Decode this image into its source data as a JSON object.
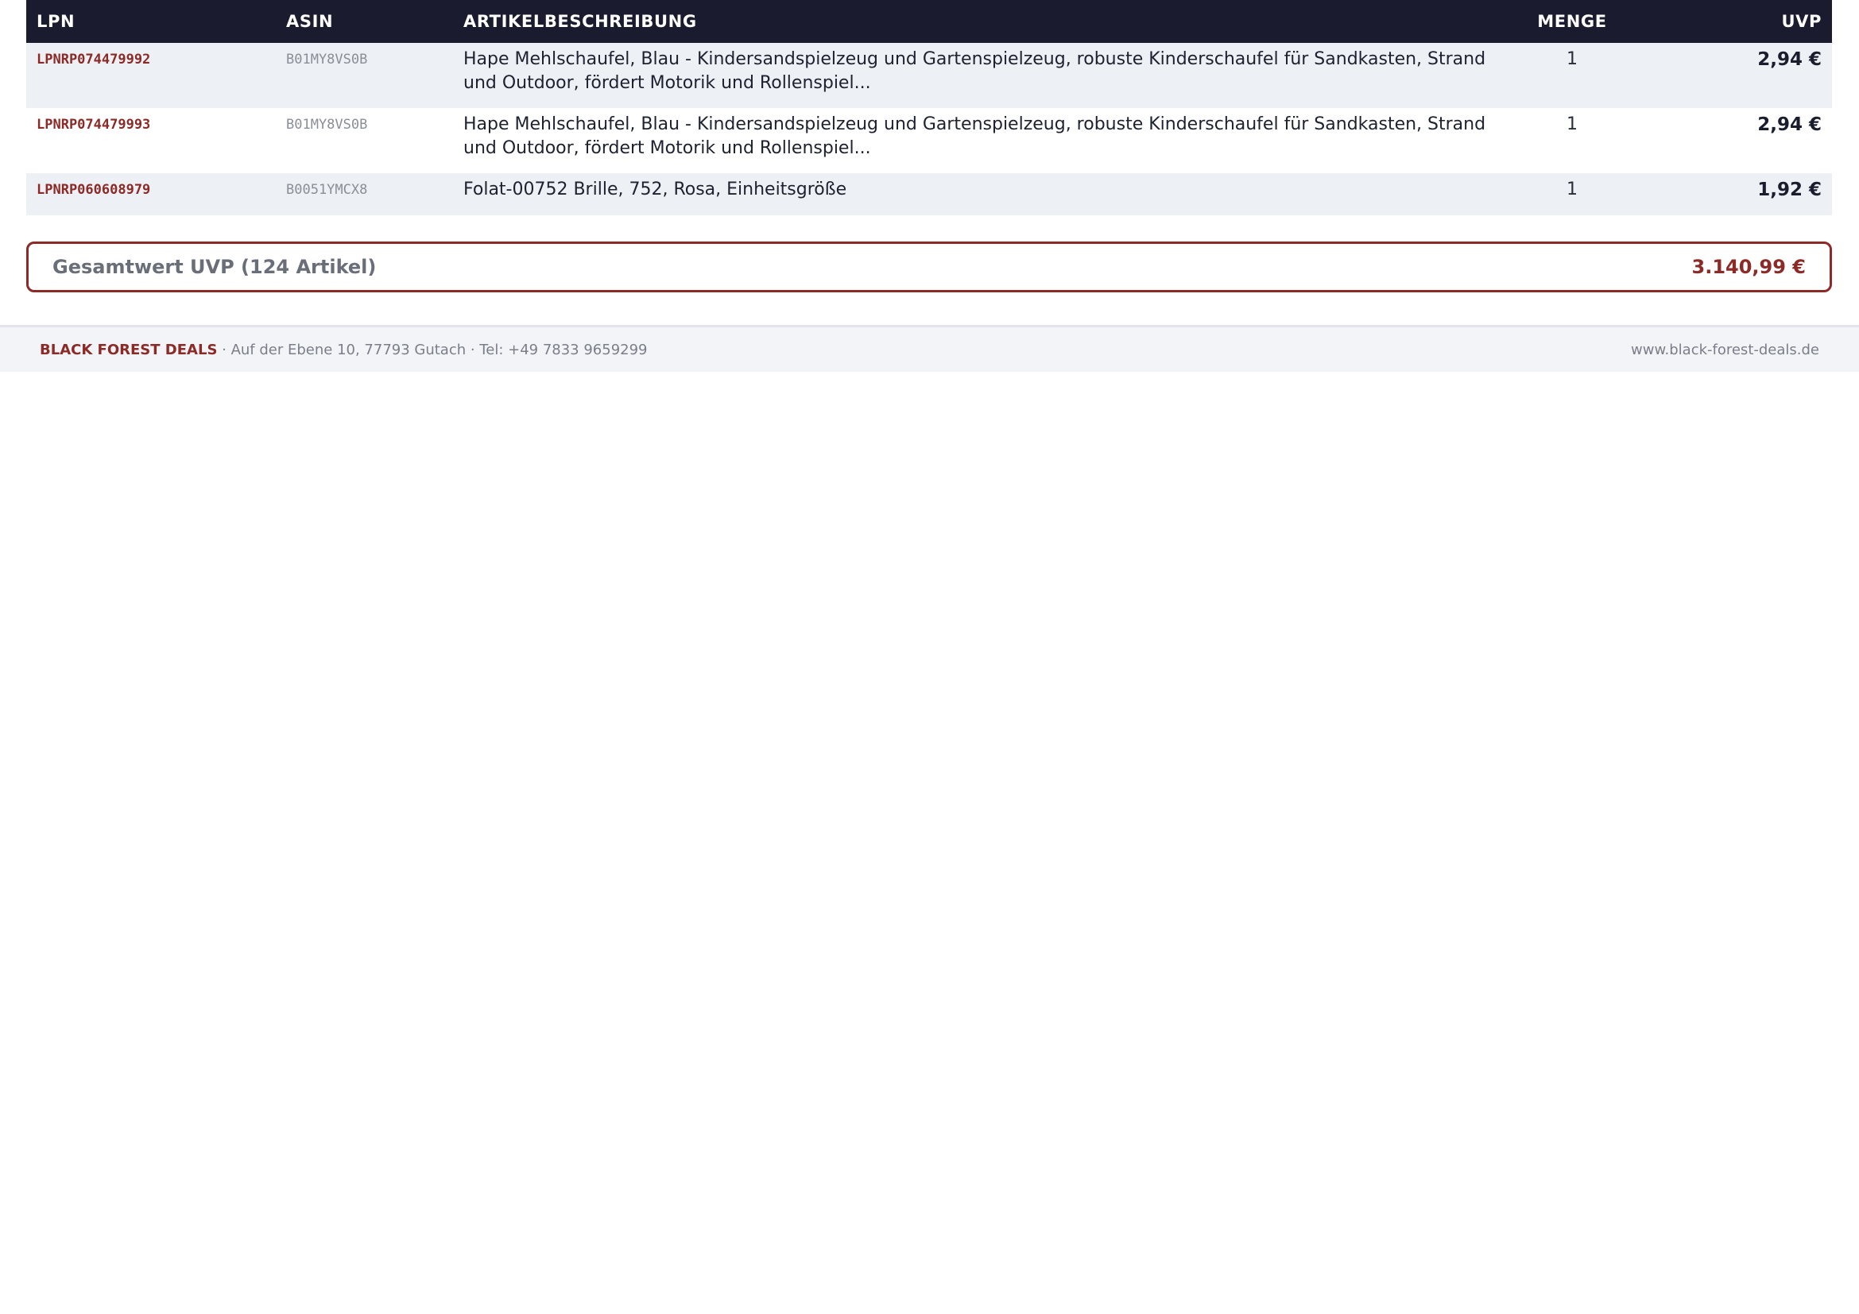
{
  "table": {
    "headers": {
      "lpn": "LPN",
      "asin": "ASIN",
      "desc": "ARTIKELBESCHREIBUNG",
      "qty": "MENGE",
      "uvp": "UVP"
    },
    "rows": [
      {
        "lpn": "LPNRP074479992",
        "asin": "B01MY8VS0B",
        "desc": "Hape Mehlschaufel, Blau - Kindersandspielzeug und Gartenspielzeug, robuste Kinderschaufel für Sandkasten, Strand und Outdoor, fördert Motorik und Rollenspiel...",
        "qty": "1",
        "uvp": "2,94 €"
      },
      {
        "lpn": "LPNRP074479993",
        "asin": "B01MY8VS0B",
        "desc": "Hape Mehlschaufel, Blau - Kindersandspielzeug und Gartenspielzeug, robuste Kinderschaufel für Sandkasten, Strand und Outdoor, fördert Motorik und Rollenspiel...",
        "qty": "1",
        "uvp": "2,94 €"
      },
      {
        "lpn": "LPNRP060608979",
        "asin": "B0051YMCX8",
        "desc": "Folat-00752 Brille, 752, Rosa, Einheitsgröße",
        "qty": "1",
        "uvp": "1,92 €"
      }
    ]
  },
  "total": {
    "label": "Gesamtwert UVP (124 Artikel)",
    "value": "3.140,99 €"
  },
  "footer": {
    "company": "BLACK FOREST DEALS",
    "details": " · Auf der Ebene 10, 77793 Gutach · Tel: +49 7833 9659299",
    "website": "www.black-forest-deals.de"
  },
  "colors": {
    "header_bg": "#1b1b2f",
    "accent": "#8b2a26",
    "row_stripe": "#edf0f4",
    "footer_bg": "#f3f4f8"
  }
}
